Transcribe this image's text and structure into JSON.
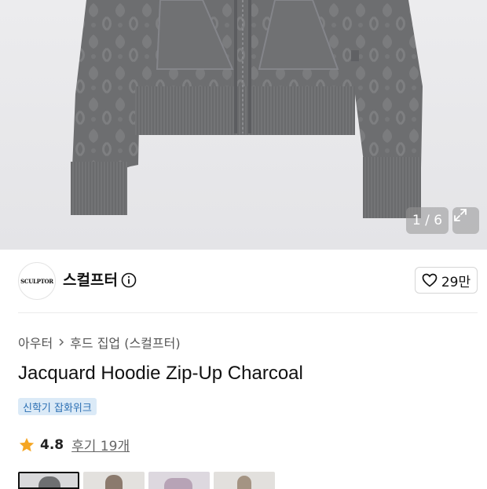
{
  "gallery": {
    "counter": "1 / 6",
    "expand_icon": "expand-icon"
  },
  "brand": {
    "logo_text": "SCULPTOR",
    "name": "스컬프터",
    "likes": "29만"
  },
  "breadcrumb": {
    "category": "아우터",
    "subcategory": "후드 집업 (스컬프터)"
  },
  "product": {
    "title": "Jacquard Hoodie Zip-Up Charcoal",
    "tag": "신학기 잡화위크"
  },
  "rating": {
    "value": "4.8",
    "reviews": "후기 19개"
  },
  "colors": {
    "star": "#f5a623",
    "tag_bg": "#dbeaf7",
    "tag_text": "#2b6fb3"
  }
}
